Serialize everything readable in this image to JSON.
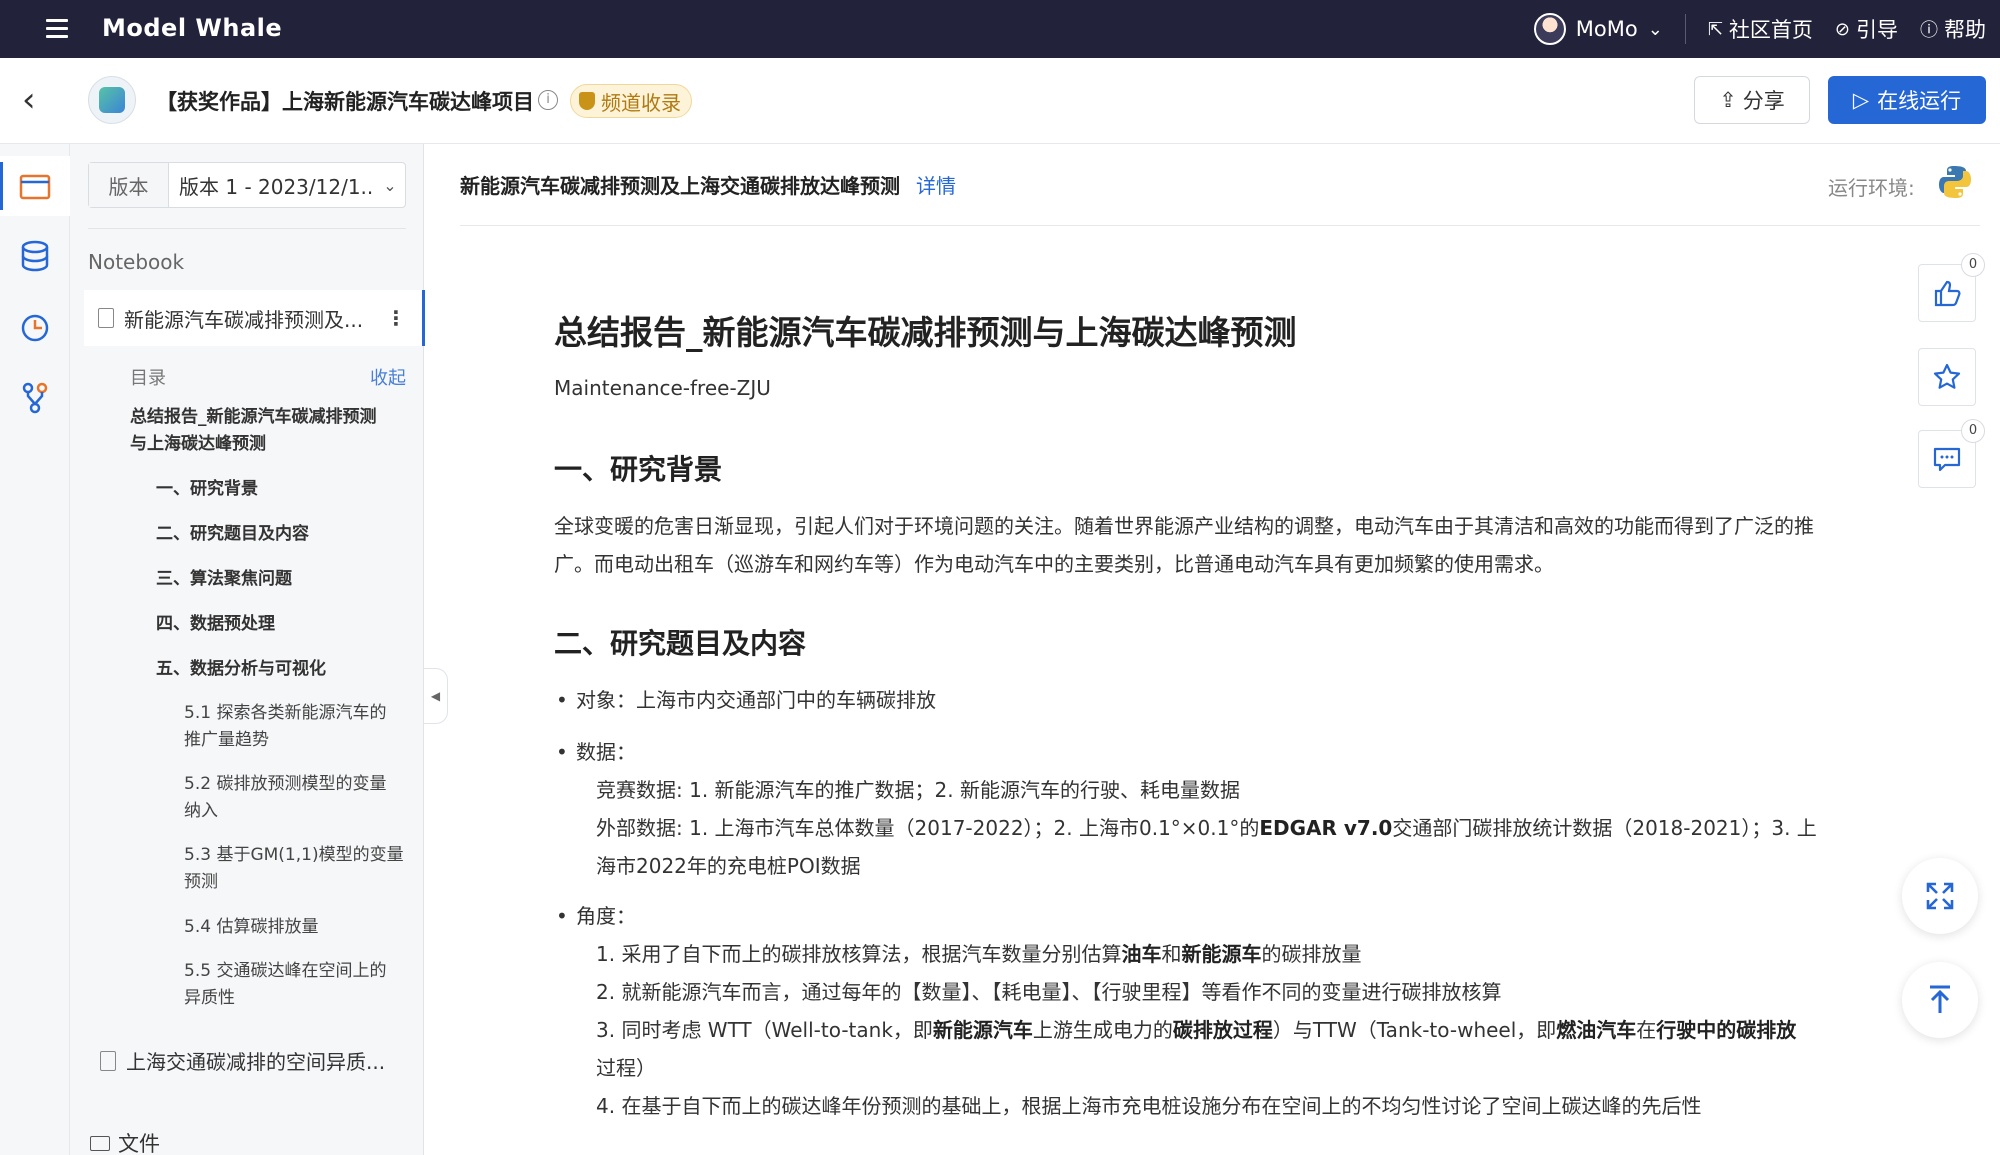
{
  "topbar": {
    "brand": "Model Whale",
    "user": "MoMo",
    "links": [
      {
        "label": "社区首页",
        "icon": "exit-icon"
      },
      {
        "label": "引导",
        "icon": "compass-icon"
      },
      {
        "label": "帮助",
        "icon": "help-icon"
      }
    ]
  },
  "header": {
    "title": "【获奖作品】上海新能源汽车碳达峰项目",
    "badge": "频道收录",
    "share": "分享",
    "run": "在线运行"
  },
  "sidebar": {
    "version_label": "版本",
    "version_value": "版本 1 - 2023/12/1...",
    "section": "Notebook",
    "active_file": "新能源汽车碳减排预测及...",
    "toc_title": "目录",
    "toc_collapse": "收起",
    "toc": [
      "总结报告_新能源汽车碳减排预测",
      "与上海碳达峰预测",
      "一、研究背景",
      "二、研究题目及内容",
      "三、算法聚焦问题",
      "四、数据预处理",
      "五、数据分析与可视化",
      "5.1 探索各类新能源汽车的",
      "推广量趋势",
      "5.2 碳排放预测模型的变量",
      "纳入",
      "5.3 基于GM(1,1)模型的变量",
      "预测",
      "5.4 估算碳排放量",
      "5.5 交通碳达峰在空间上的",
      "异质性"
    ],
    "second_file": "上海交通碳减排的空间异质...",
    "files": "文件"
  },
  "main": {
    "notebook_title": "新能源汽车碳减排预测及上海交通碳排放达峰预测",
    "details": "详情",
    "env_label": "运行环境:",
    "doc_title": "总结报告_新能源汽车碳减排预测与上海碳达峰预测",
    "author": "Maintenance-free-ZJU",
    "h2_1": "一、研究背景",
    "para1_line1": "全球变暖的危害日渐显现，引起人们对于环境问题的关注。随着世界能源产业结构的调整，电动汽车由于其清洁和高效的功能而得到了广泛的推",
    "para1_line2": "广。而电动出租车（巡游车和网约车等）作为电动汽车中的主要类别，比普通电动汽车具有更加频繁的使用需求。",
    "h2_2": "二、研究题目及内容",
    "b1": "对象：上海市内交通部门中的车辆碳排放",
    "b2": "数据：",
    "d1": "竞赛数据: 1. 新能源汽车的推广数据；2. 新能源汽车的行驶、耗电量数据",
    "d2a": "外部数据: 1. 上海市汽车总体数量（2017-2022）；2. 上海市0.1°×0.1°的",
    "d2b": "EDGAR v7.0",
    "d2c": "交通部门碳排放统计数据（2018-2021）；3. 上",
    "d3": "海市2022年的充电桩POI数据",
    "b3": "角度：",
    "a1a": "1. 采用了自下而上的碳排放核算法，根据汽车数量分别估算",
    "a1b": "油车",
    "a1c": "和",
    "a1d": "新能源车",
    "a1e": "的碳排放量",
    "a2": "2. 就新能源汽车而言，通过每年的【数量】、【耗电量】、【行驶里程】等看作不同的变量进行碳排放核算",
    "a3a": "3. 同时考虑 WTT（Well-to-tank，即",
    "a3b": "新能源汽车",
    "a3c": "上游生成电力的",
    "a3d": "碳排放过程",
    "a3e": "）与TTW（Tank-to-wheel，即",
    "a3f": "燃油汽车",
    "a3g": "在",
    "a3h": "行驶中的碳排放",
    "a3i": "过程）",
    "a4": "4. 在基于自下而上的碳达峰年份预测的基础上，根据上海市充电桩设施分布在空间上的不均匀性讨论了空间上碳达峰的先后性"
  },
  "floating": {
    "like_count": "0",
    "comment_count": "0"
  },
  "colors": {
    "topbar": "#22223a",
    "accent": "#2667d6",
    "badge_bg": "#fdf3d8"
  }
}
